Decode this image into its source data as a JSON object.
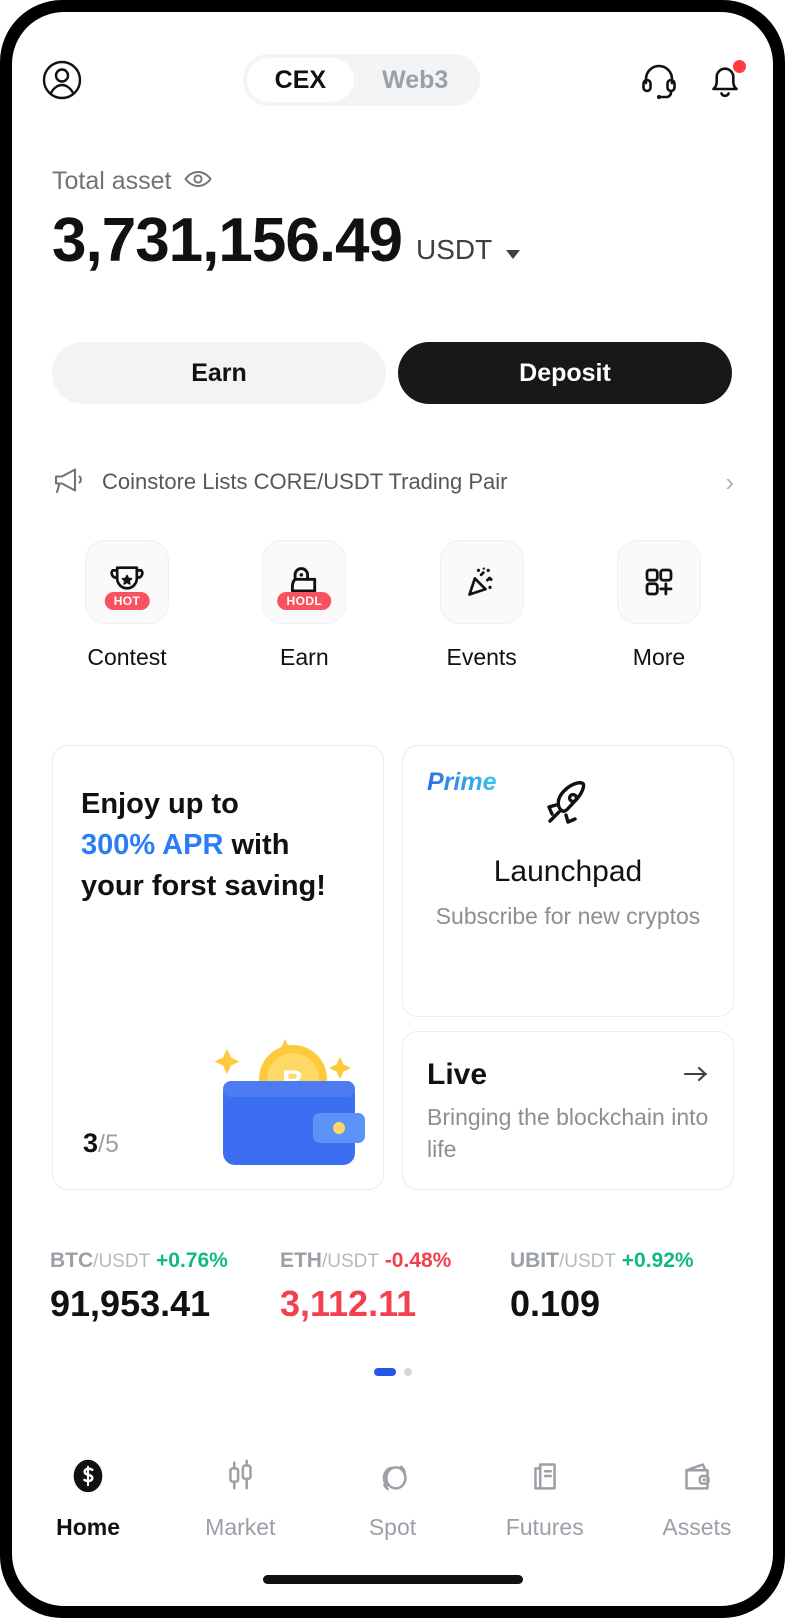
{
  "header": {
    "profile_icon": "user-circle-icon",
    "tabs": [
      {
        "label": "CEX",
        "active": true
      },
      {
        "label": "Web3",
        "active": false
      }
    ],
    "support_icon": "headset-icon",
    "notification_icon": "bell-icon",
    "notification_badge": true
  },
  "balance": {
    "label": "Total asset",
    "visibility_icon": "eye-icon",
    "amount": "3,731,156.49",
    "currency": "USDT",
    "currency_caret": "chevron-down-icon"
  },
  "actions": {
    "earn_label": "Earn",
    "deposit_label": "Deposit"
  },
  "announcement": {
    "icon": "megaphone-icon",
    "text": "Coinstore Lists CORE/USDT Trading Pair",
    "chevron": "›"
  },
  "quick_actions": [
    {
      "label": "Contest",
      "icon": "trophy-icon",
      "badge": "HOT"
    },
    {
      "label": "Earn",
      "icon": "piggy-hodl-icon",
      "badge": "HODL"
    },
    {
      "label": "Events",
      "icon": "party-popper-icon",
      "badge": ""
    },
    {
      "label": "More",
      "icon": "grid-plus-icon",
      "badge": ""
    }
  ],
  "promo_card": {
    "line1": "Enjoy up to",
    "highlight": "300% APR",
    "line2_rest": " with",
    "line3": "your forst saving!",
    "counter_current": "3",
    "counter_total": "/5",
    "art": "wallet-bitcoin-illustration"
  },
  "prime_card": {
    "tag": "Prime",
    "icon": "rocket-icon",
    "title": "Launchpad",
    "subtitle": "Subscribe for new cryptos"
  },
  "live_card": {
    "title": "Live",
    "arrow_icon": "arrow-right-icon",
    "subtitle": "Bringing the blockchain into life"
  },
  "tickers": [
    {
      "base": "BTC",
      "quote": "/USDT",
      "change": "+0.76%",
      "direction": "up",
      "price": "91,953.41"
    },
    {
      "base": "ETH",
      "quote": "/USDT",
      "change": "-0.48%",
      "direction": "down",
      "price": "3,112.11"
    },
    {
      "base": "UBIT",
      "quote": "/USDT",
      "change": "+0.92%",
      "direction": "up",
      "price": "0.109"
    }
  ],
  "pagination": {
    "pages": 2,
    "active_index": 0
  },
  "bottom_nav": [
    {
      "label": "Home",
      "icon": "coinstore-logo-icon",
      "active": true
    },
    {
      "label": "Market",
      "icon": "candlestick-icon",
      "active": false
    },
    {
      "label": "Spot",
      "icon": "spot-swap-icon",
      "active": false
    },
    {
      "label": "Futures",
      "icon": "document-chart-icon",
      "active": false
    },
    {
      "label": "Assets",
      "icon": "wallet-icon",
      "active": false
    }
  ],
  "colors": {
    "accent_blue": "#2a7cf7",
    "up_green": "#0fba81",
    "down_red": "#f0414e",
    "badge_red": "#f9525f",
    "dark": "#181818"
  }
}
